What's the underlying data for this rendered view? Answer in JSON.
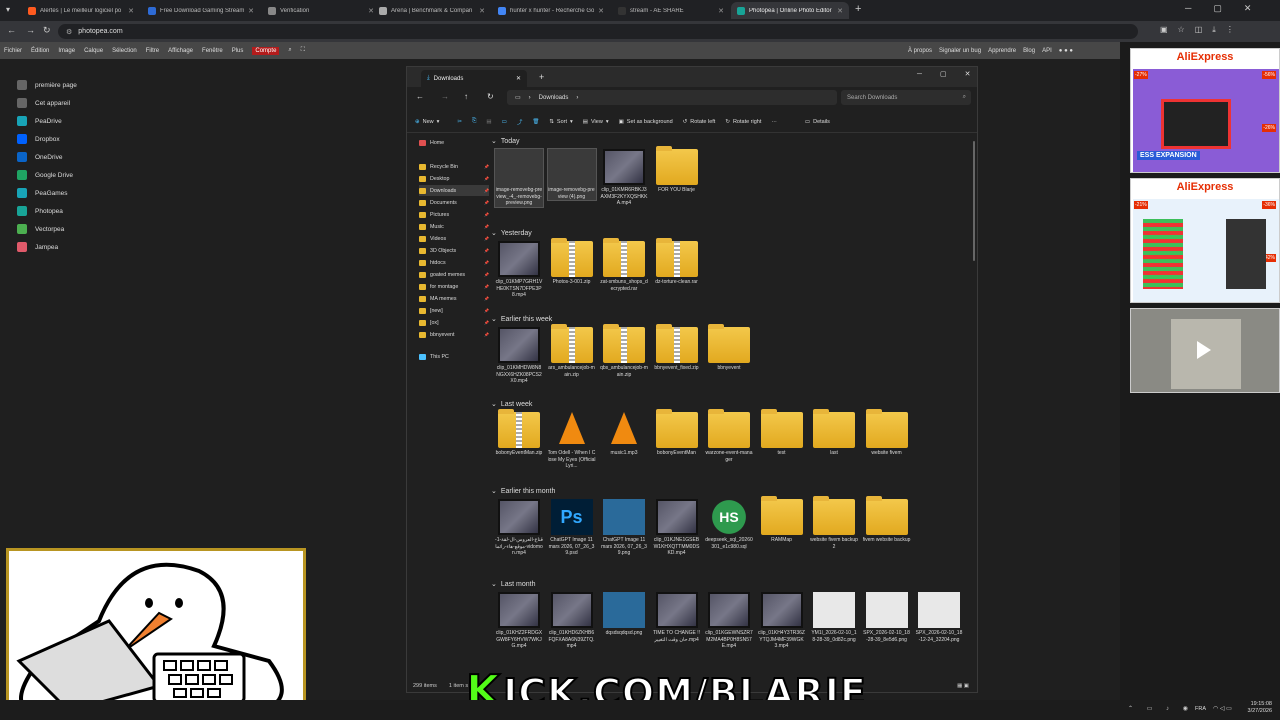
{
  "browser": {
    "tabs": [
      {
        "label": "Alertes | Le meilleur logiciel po",
        "color": "#ff5a1f"
      },
      {
        "label": "Free Download Gaming Stream",
        "color": "#2e6bd6"
      },
      {
        "label": "Verification",
        "color": "#888888"
      },
      {
        "label": "Arena | Benchmark & Compari",
        "color": "#aaaaaa"
      },
      {
        "label": "hunter x hunter - Recherche Go",
        "color": "#4285f4"
      },
      {
        "label": "stream - AE SHARE",
        "color": "#333333"
      },
      {
        "label": "Photopea | Online Photo Editor",
        "color": "#18a497"
      }
    ],
    "url": "photopea.com",
    "new_tab": "+"
  },
  "photopea": {
    "menu": [
      "Fichier",
      "Édition",
      "Image",
      "Calque",
      "Sélection",
      "Filtre",
      "Affichage",
      "Fenêtre",
      "Plus"
    ],
    "account": "Compte",
    "right_links": [
      "À propos",
      "Signaler un bug",
      "Apprendre",
      "Blog",
      "API"
    ],
    "sidebar": [
      {
        "label": "première page",
        "color": "#666666"
      },
      {
        "label": "Cet appareil",
        "color": "#666666"
      },
      {
        "label": "PeaDrive",
        "color": "#18a4b7"
      },
      {
        "label": "Dropbox",
        "color": "#0061fe"
      },
      {
        "label": "OneDrive",
        "color": "#0a64c8"
      },
      {
        "label": "Google Drive",
        "color": "#1fa463"
      },
      {
        "label": "PeaGames",
        "color": "#18a4b7"
      },
      {
        "label": "Photopea",
        "color": "#18a497"
      },
      {
        "label": "Vectorpea",
        "color": "#4caf50"
      },
      {
        "label": "Jampea",
        "color": "#e05a6a"
      }
    ]
  },
  "ads": [
    {
      "brand": "AliExpress",
      "badges": [
        "-27%",
        "-56%",
        "-26%"
      ],
      "caption": "ESS EXPANSION"
    },
    {
      "brand": "AliExpress",
      "badges": [
        "-21%",
        "-36%",
        "-42%"
      ],
      "caption": ""
    }
  ],
  "explorer": {
    "tab_title": "Downloads",
    "breadcrumb": "Downloads",
    "search_placeholder": "Search Downloads",
    "toolbar": [
      "New",
      "Sort",
      "View",
      "Set as background",
      "Rotate left",
      "Rotate right",
      "Details"
    ],
    "nav": [
      {
        "label": "Home"
      },
      {
        "label": "Recycle Bin"
      },
      {
        "label": "Desktop"
      },
      {
        "label": "Downloads"
      },
      {
        "label": "Documents"
      },
      {
        "label": "Pictures"
      },
      {
        "label": "Music"
      },
      {
        "label": "Videos"
      },
      {
        "label": "3D Objects"
      },
      {
        "label": "htdocs"
      },
      {
        "label": "goated memes"
      },
      {
        "label": "for montage"
      },
      {
        "label": "MA memes"
      },
      {
        "label": "[new]"
      },
      {
        "label": "[ox]"
      },
      {
        "label": "bbnyevent"
      },
      {
        "label": "This PC"
      }
    ],
    "groups": [
      {
        "title": "Today",
        "files": [
          {
            "name": "image-removebg-preview_-4_-removebg-preview.png",
            "kind": "img"
          },
          {
            "name": "image-removebg-preview (4).png",
            "kind": "img"
          },
          {
            "name": "clip_01KMR6RBKJ3AXM3F2KYXQSHKKA.mp4",
            "kind": "vid"
          },
          {
            "name": "FOR YOU Blarje",
            "kind": "folder"
          }
        ]
      },
      {
        "title": "Yesterday",
        "files": [
          {
            "name": "clip_01KMP7GRH1VHE0KTSN7DFPE3P8.mp4",
            "kind": "vid"
          },
          {
            "name": "Photos-3-001.zip",
            "kind": "zip"
          },
          {
            "name": "zat-smbuns_shops_decrypted.rar",
            "kind": "zip"
          },
          {
            "name": "dz-torture-clean.rar",
            "kind": "zip"
          }
        ]
      },
      {
        "title": "Earlier this week",
        "files": [
          {
            "name": "clip_01KMHDW8N8NGXX6HZK08PCS2X0.mp4",
            "kind": "vid"
          },
          {
            "name": "ars_ambulancejob-main.zip",
            "kind": "zip"
          },
          {
            "name": "qbs_ambulancejob-main.zip",
            "kind": "zip"
          },
          {
            "name": "bbnyevent_fixed.zip",
            "kind": "zip"
          },
          {
            "name": "bbnyevent",
            "kind": "folder"
          }
        ]
      },
      {
        "title": "Last week",
        "files": [
          {
            "name": "bobonyEventMan.zip",
            "kind": "zip"
          },
          {
            "name": "Tom Odell - When I Close My Eyes (Official Lyri...",
            "kind": "vlc"
          },
          {
            "name": "music1.mp3",
            "kind": "vlc"
          },
          {
            "name": "bobonyEventMan",
            "kind": "folder"
          },
          {
            "name": "warzone-event-manager",
            "kind": "folder"
          },
          {
            "name": "test",
            "kind": "folder"
          },
          {
            "name": "last",
            "kind": "folder"
          },
          {
            "name": "website fivem",
            "kind": "folder"
          }
        ]
      },
      {
        "title": "Earlier this month",
        "files": [
          {
            "name": "قناع-العروس-ال-لقة-1-موقع-هاء-رائما-vidomon.mp4",
            "kind": "vid"
          },
          {
            "name": "ChatGPT Image 11 mars 2026, 07_26_39.psd",
            "kind": "ps"
          },
          {
            "name": "ChatGPT Image 11 mars 2026, 07_26_39.png",
            "kind": "img"
          },
          {
            "name": "clip_01KJNE1GSEBW1KHXQTTMM0DSKD.mp4",
            "kind": "vid"
          },
          {
            "name": "deepseek_sql_20260301_e1c980.sql",
            "kind": "hs"
          },
          {
            "name": "RAMMap",
            "kind": "folder"
          },
          {
            "name": "website fivem backup 2",
            "kind": "folder"
          },
          {
            "name": "fivem website backup",
            "kind": "folder"
          }
        ]
      },
      {
        "title": "Last month",
        "files": [
          {
            "name": "clip_01KHZ2FRDGXGW8FY6HVW7WKJG.mp4",
            "kind": "vid"
          },
          {
            "name": "clip_01KHD6ZKHB6FQFXA8A6N39ZTQ.mp4",
            "kind": "vid"
          },
          {
            "name": "dqsdsqdqsd.png",
            "kind": "img"
          },
          {
            "name": "TIME TO CHANGE !! حان وقت التغيير.mp4",
            "kind": "vid"
          },
          {
            "name": "clip_01KGEWNSZR7M2MA4BP0H8SN57E.mp4",
            "kind": "vid"
          },
          {
            "name": "clip_01KH4Y3TR36ZYTQJM4MF39WGK3.mp4",
            "kind": "vid"
          },
          {
            "name": "YM1l_2026-02-10_18-28-39_0d82c.png",
            "kind": "img"
          },
          {
            "name": "SPX_2026-02-10_18-28-39_8e5d6.png",
            "kind": "img"
          },
          {
            "name": "SPX_2026-02-10_18-12-24_32204.png",
            "kind": "img"
          }
        ]
      }
    ],
    "status_count": "299 items",
    "status_sel": "1 item s"
  },
  "overlay_text": "KICK.COM/BLARJE",
  "clock": {
    "time": "19:15:08",
    "date": "3/27/2026",
    "lang": "FRA"
  }
}
